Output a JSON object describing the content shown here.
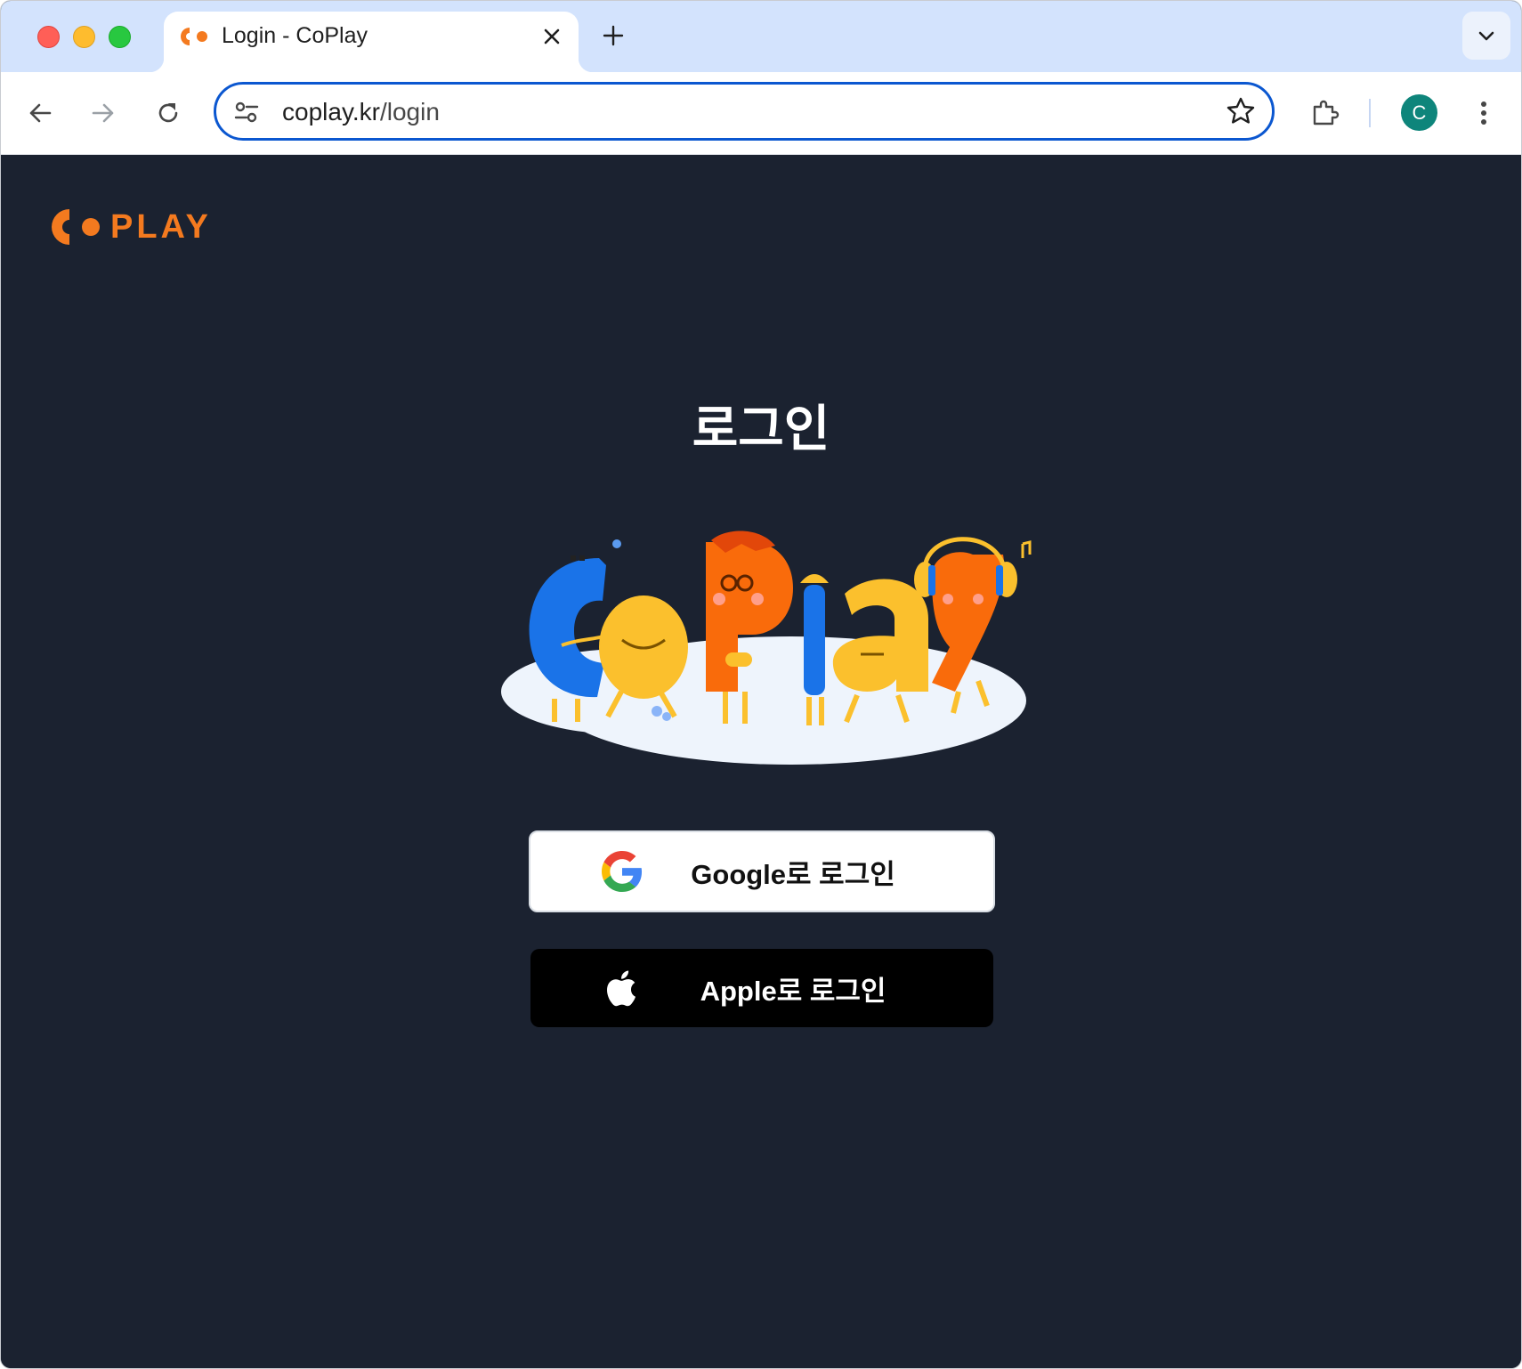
{
  "browser": {
    "tab": {
      "title": "Login - CoPlay",
      "favicon": "coplay-logo-icon"
    },
    "address_bar": {
      "host": "coplay.kr",
      "path": "/login"
    },
    "profile_initial": "C",
    "colors": {
      "tab_strip": "#d3e3fd",
      "omnibox_border": "#0b57d0",
      "avatar": "#0e857b"
    }
  },
  "page": {
    "logo_text": "PLAY",
    "heading": "로그인",
    "buttons": {
      "google": {
        "label": "Google로 로그인",
        "icon": "google-icon"
      },
      "apple": {
        "label": "Apple로 로그인",
        "icon": "apple-icon"
      }
    },
    "colors": {
      "background": "#1b2230",
      "brand": "#f47a1f"
    }
  }
}
